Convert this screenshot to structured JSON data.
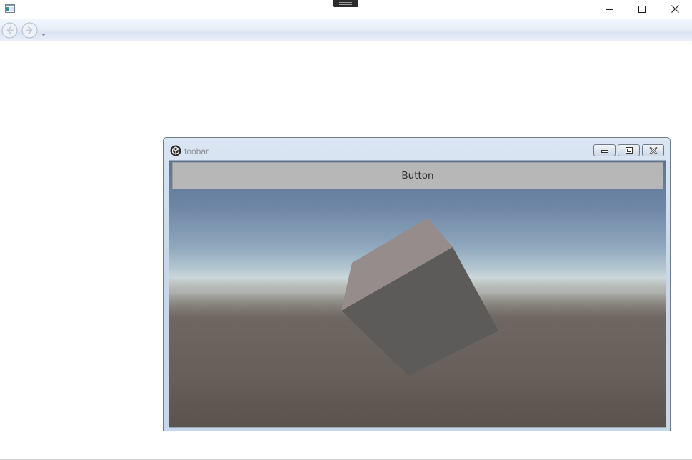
{
  "window": {
    "title": "",
    "icon": "app-window-icon",
    "controls": {
      "minimize_icon": "minimize-icon",
      "maximize_icon": "maximize-icon",
      "close_icon": "close-icon"
    }
  },
  "navigation": {
    "back_icon": "back-arrow-icon",
    "forward_icon": "forward-arrow-icon",
    "history_icon": "chevron-down-icon"
  },
  "inner_window": {
    "title": "foobar",
    "icon": "unity-icon",
    "controls": {
      "minimize_icon": "minimize-icon",
      "restore_icon": "restore-icon",
      "close_icon": "close-icon"
    }
  },
  "viewport": {
    "button_label": "Button",
    "scene_object": "cube",
    "colors": {
      "cube_top": "#968c8b",
      "cube_front": "#5c5b5a",
      "sky": "#5d7494",
      "ground": "#6e6761"
    }
  }
}
